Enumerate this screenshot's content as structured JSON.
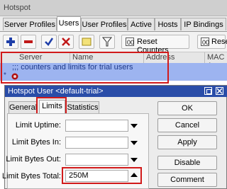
{
  "window": {
    "title": "Hotspot"
  },
  "tabs": [
    "Server Profiles",
    "Users",
    "User Profiles",
    "Active",
    "Hosts",
    "IP Bindings"
  ],
  "active_tab": "Users",
  "toolbar": {
    "icons": [
      "add-icon",
      "remove-icon",
      "enable-icon",
      "disable-icon",
      "comment-icon",
      "filter-icon"
    ],
    "reset_counters_label": "Reset Counters",
    "reset_label": "Reset"
  },
  "table": {
    "columns": [
      "Server",
      "Name",
      "Address",
      "MAC A"
    ],
    "comment_row": ";;; counters and limits for trial users",
    "row_marker": "*"
  },
  "dialog": {
    "title": "Hotspot User <default-trial>",
    "tabs": [
      "General",
      "Limits",
      "Statistics"
    ],
    "active_tab": "Limits",
    "fields": [
      {
        "label": "Limit Uptime:",
        "value": ""
      },
      {
        "label": "Limit Bytes In:",
        "value": ""
      },
      {
        "label": "Limit Bytes Out:",
        "value": ""
      },
      {
        "label": "Limit Bytes Total:",
        "value": "250M"
      }
    ],
    "buttons": [
      "OK",
      "Cancel",
      "Apply",
      "Disable",
      "Comment"
    ]
  },
  "colors": {
    "highlight": "#d11a1a",
    "title_bar": "#2a4da8",
    "selected_row": "#9db4f0"
  }
}
